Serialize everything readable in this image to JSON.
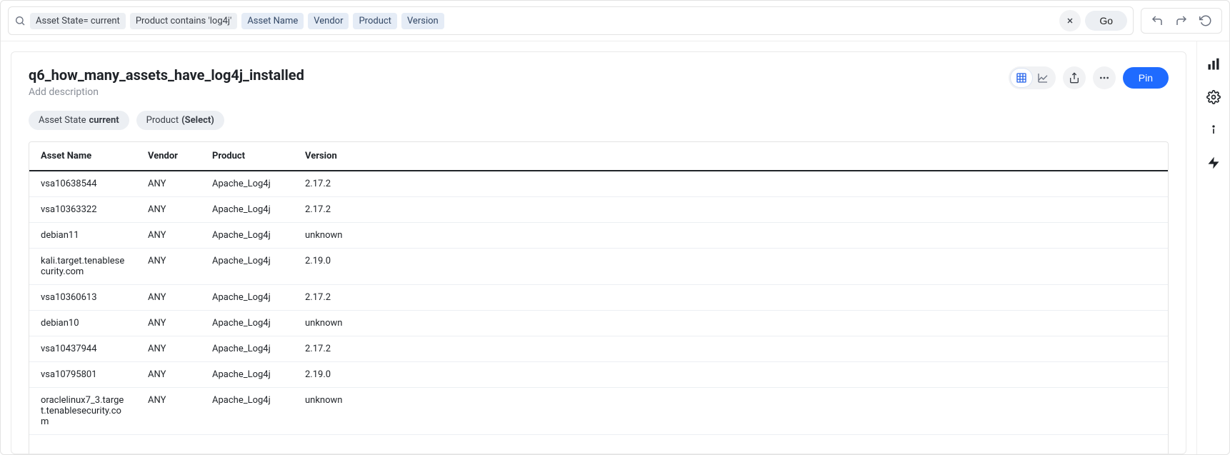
{
  "query": {
    "filters": [
      {
        "text": "Asset State= current",
        "kind": "filter"
      },
      {
        "text": "Product contains 'log4j'",
        "kind": "filter"
      },
      {
        "text": "Asset Name",
        "kind": "column"
      },
      {
        "text": "Vendor",
        "kind": "column"
      },
      {
        "text": "Product",
        "kind": "column"
      },
      {
        "text": "Version",
        "kind": "column"
      }
    ],
    "go_label": "Go"
  },
  "header": {
    "title": "q6_how_many_assets_have_log4j_installed",
    "description_placeholder": "Add description",
    "pin_label": "Pin"
  },
  "applied_filters": [
    {
      "label": "Asset State",
      "value": "current"
    },
    {
      "label": "Product",
      "value": "(Select)"
    }
  ],
  "table": {
    "columns": [
      "Asset Name",
      "Vendor",
      "Product",
      "Version"
    ],
    "rows": [
      {
        "asset_name": "vsa10638544",
        "vendor": "ANY",
        "product": "Apache_Log4j",
        "version": "2.17.2"
      },
      {
        "asset_name": "vsa10363322",
        "vendor": "ANY",
        "product": "Apache_Log4j",
        "version": "2.17.2"
      },
      {
        "asset_name": "debian11",
        "vendor": "ANY",
        "product": "Apache_Log4j",
        "version": "unknown"
      },
      {
        "asset_name": "kali.target.tenablesecurity.com",
        "vendor": "ANY",
        "product": "Apache_Log4j",
        "version": "2.19.0"
      },
      {
        "asset_name": "vsa10360613",
        "vendor": "ANY",
        "product": "Apache_Log4j",
        "version": "2.17.2"
      },
      {
        "asset_name": "debian10",
        "vendor": "ANY",
        "product": "Apache_Log4j",
        "version": "unknown"
      },
      {
        "asset_name": "vsa10437944",
        "vendor": "ANY",
        "product": "Apache_Log4j",
        "version": "2.17.2"
      },
      {
        "asset_name": "vsa10795801",
        "vendor": "ANY",
        "product": "Apache_Log4j",
        "version": "2.19.0"
      },
      {
        "asset_name": "oraclelinux7_3.target.tenablesecurity.com",
        "vendor": "ANY",
        "product": "Apache_Log4j",
        "version": "unknown"
      }
    ]
  }
}
